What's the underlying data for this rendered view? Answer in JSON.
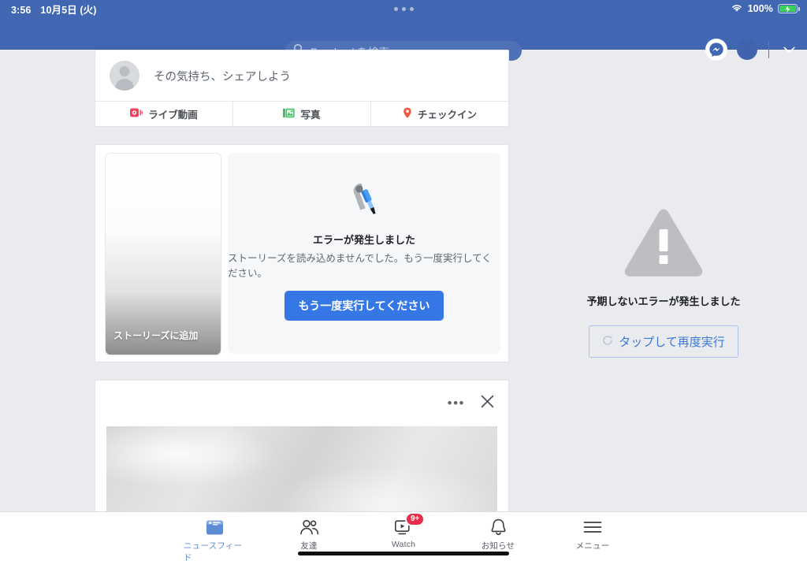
{
  "status_bar": {
    "time": "3:56",
    "date": "10月5日 (火)",
    "battery_percent": "100%",
    "wifi_icon": "wifi-icon",
    "battery_icon": "battery-charging-icon",
    "dots_icon": "recording-dots-icon"
  },
  "nav": {
    "search_placeholder": "Facebookを検索",
    "search_icon": "search-icon",
    "messenger_icon": "messenger-icon",
    "avatar_icon": "avatar",
    "chevron_icon": "chevron-down-icon"
  },
  "composer": {
    "placeholder": "その気持ち、シェアしよう",
    "avatar_icon": "avatar",
    "actions": [
      {
        "label": "ライブ動画",
        "icon": "live-video-icon",
        "color": "#f3425f"
      },
      {
        "label": "写真",
        "icon": "photo-icon",
        "color": "#45bd62"
      },
      {
        "label": "チェックイン",
        "icon": "location-pin-icon",
        "color": "#f5533d"
      }
    ]
  },
  "stories": {
    "add_story_label": "ストーリーズに追加",
    "error": {
      "icon": "wrench-screwdriver-icon",
      "title": "エラーが発生しました",
      "subtitle": "ストーリーズを読み込めませんでした。もう一度実行してください。",
      "button_label": "もう一度実行してください",
      "button_color": "#3578e5"
    }
  },
  "post": {
    "menu_icon": "more-options-icon",
    "close_icon": "close-icon",
    "menu_label": "•••",
    "media_icon": "post-image"
  },
  "right_rail": {
    "icon": "warning-triangle-icon",
    "title": "予期しないエラーが発生しました",
    "button_label": "タップして再度実行",
    "button_icon": "refresh-icon",
    "button_text_color": "#3b78d8"
  },
  "tabbar": {
    "items": [
      {
        "label": "ニュースフィード",
        "icon": "news-feed-icon",
        "active": true,
        "badge": ""
      },
      {
        "label": "友達",
        "icon": "friends-icon",
        "active": false,
        "badge": ""
      },
      {
        "label": "Watch",
        "icon": "watch-icon",
        "active": false,
        "badge": "9+"
      },
      {
        "label": "お知らせ",
        "icon": "bell-icon",
        "active": false,
        "badge": ""
      },
      {
        "label": "メニュー",
        "icon": "hamburger-menu-icon",
        "active": false,
        "badge": ""
      }
    ]
  },
  "colors": {
    "brand_blue": "#4267b2",
    "accent_blue": "#3578e5",
    "page_bg": "#e9ebee",
    "badge_red": "#e62e4d"
  }
}
